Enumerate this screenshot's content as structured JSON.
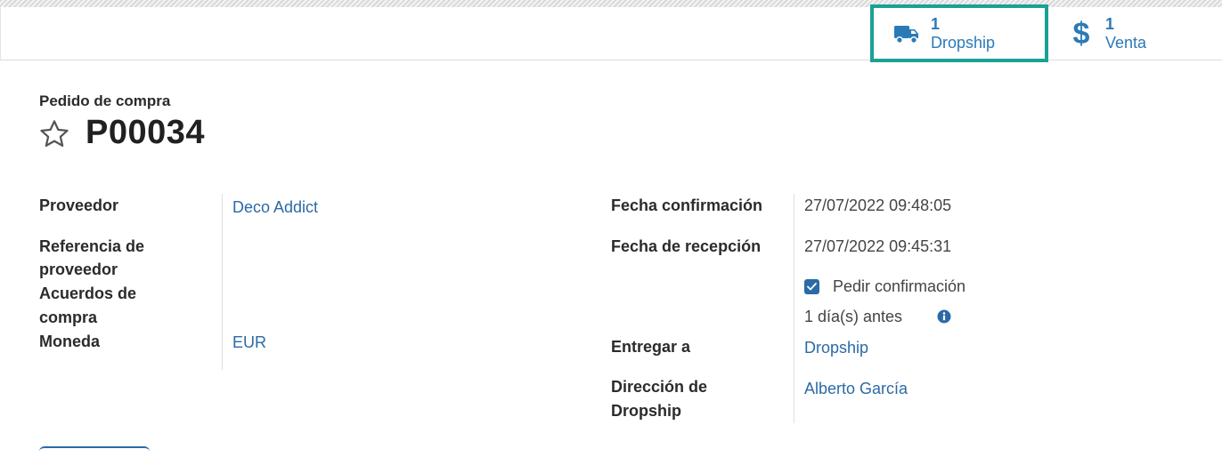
{
  "smart_buttons": {
    "dropship": {
      "count": "1",
      "label": "Dropship",
      "icon": "truck-icon"
    },
    "venta": {
      "count": "1",
      "label": "Venta",
      "icon": "dollar-icon"
    }
  },
  "header": {
    "subtitle": "Pedido de compra",
    "title": "P00034",
    "favorite_icon": "star-icon"
  },
  "left_fields": {
    "proveedor": {
      "label": "Proveedor",
      "value": "Deco Addict"
    },
    "referencia": {
      "label_line1": "Referencia de",
      "label_line2": "proveedor",
      "value": ""
    },
    "acuerdos": {
      "label_line1": "Acuerdos de",
      "label_line2": "compra",
      "value": ""
    },
    "moneda": {
      "label": "Moneda",
      "value": "EUR"
    }
  },
  "right_fields": {
    "fecha_confirmacion": {
      "label": "Fecha confirmación",
      "value": "27/07/2022 09:48:05"
    },
    "fecha_recepcion": {
      "label": "Fecha de recepción",
      "value": "27/07/2022 09:45:31"
    },
    "pedir_confirmacion": {
      "label": "Pedir confirmación",
      "checked": true
    },
    "dias_antes": {
      "value": "1 día(s) antes",
      "icon": "info-icon"
    },
    "entregar_a": {
      "label": "Entregar a",
      "value": "Dropship"
    },
    "direccion": {
      "label_line1": "Dirección de",
      "label_line2": "Dropship",
      "value": "Alberto García"
    }
  },
  "colors": {
    "accent": "#2b7ab8",
    "highlight": "#1aa195",
    "link": "#2b6aa6"
  }
}
